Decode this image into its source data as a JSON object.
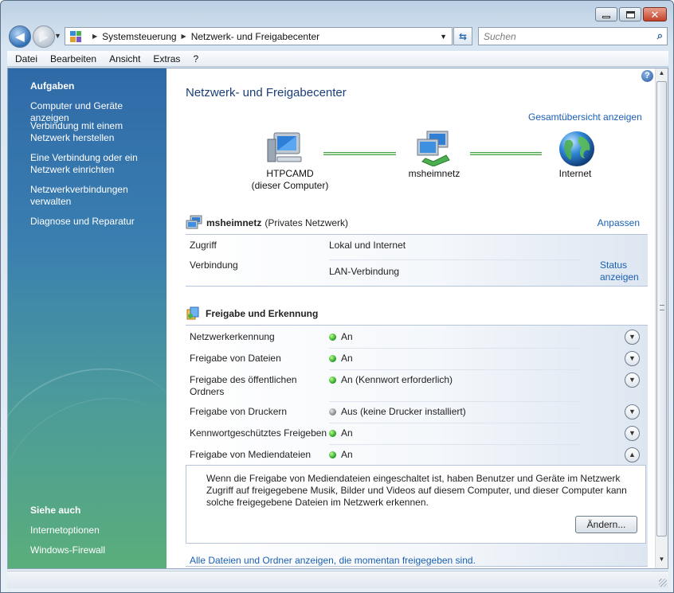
{
  "window": {
    "controls": {
      "minimize": "minimize-icon",
      "maximize": "maximize-icon",
      "close": "close-icon"
    }
  },
  "nav": {
    "back_icon": "back-arrow-icon",
    "forward_icon": "forward-arrow-icon",
    "breadcrumb": [
      "Systemsteuerung",
      "Netzwerk- und Freigabecenter"
    ],
    "search_placeholder": "Suchen"
  },
  "menu": [
    "Datei",
    "Bearbeiten",
    "Ansicht",
    "Extras",
    "?"
  ],
  "sidebar": {
    "tasks_heading": "Aufgaben",
    "tasks": [
      "Computer und Geräte anzeigen",
      "Verbindung mit einem Netzwerk herstellen",
      "Eine Verbindung oder ein Netzwerk einrichten",
      "Netzwerkverbindungen verwalten",
      "Diagnose und Reparatur"
    ],
    "see_also_heading": "Siehe auch",
    "see_also": [
      "Internetoptionen",
      "Windows-Firewall"
    ]
  },
  "main": {
    "title": "Netzwerk- und Freigabecenter",
    "overview_link": "Gesamtübersicht anzeigen",
    "map": {
      "computer_name": "HTPCAMD",
      "computer_sub": "(dieser Computer)",
      "network_name": "msheimnetz",
      "internet_label": "Internet"
    },
    "network": {
      "name": "msheimnetz",
      "type": "(Privates Netzwerk)",
      "customize_link": "Anpassen",
      "access_label": "Zugriff",
      "access_value": "Lokal und Internet",
      "connection_label": "Verbindung",
      "connection_value": "LAN-Verbindung",
      "status_link_1": "Status",
      "status_link_2": "anzeigen"
    },
    "sharing": {
      "heading": "Freigabe und Erkennung",
      "rows": [
        {
          "label": "Netzwerkerkennung",
          "value": "An",
          "status": "on"
        },
        {
          "label": "Freigabe von Dateien",
          "value": "An",
          "status": "on"
        },
        {
          "label_1": "Freigabe des öffentlichen",
          "label_2": "Ordners",
          "value": "An (Kennwort erforderlich)",
          "status": "on"
        },
        {
          "label": "Freigabe von Druckern",
          "value": "Aus (keine Drucker installiert)",
          "status": "off"
        },
        {
          "label": "Kennwortgeschütztes Freigeben",
          "value": "An",
          "status": "on"
        },
        {
          "label": "Freigabe von Mediendateien",
          "value": "An",
          "status": "on"
        }
      ],
      "media_description": "Wenn die Freigabe von Mediendateien eingeschaltet ist, haben Benutzer und Geräte im Netzwerk Zugriff auf freigegebene Musik, Bilder und Videos auf diesem Computer, und dieser Computer kann solche freigegebene Dateien im Netzwerk erkennen.",
      "change_button": "Ändern..."
    },
    "all_files_link": "Alle Dateien und Ordner anzeigen, die momentan freigegeben sind."
  },
  "colors": {
    "link": "#1a5fb4",
    "title": "#1a3e7a",
    "status_on": "#1f9a1f",
    "status_off": "#808080"
  }
}
